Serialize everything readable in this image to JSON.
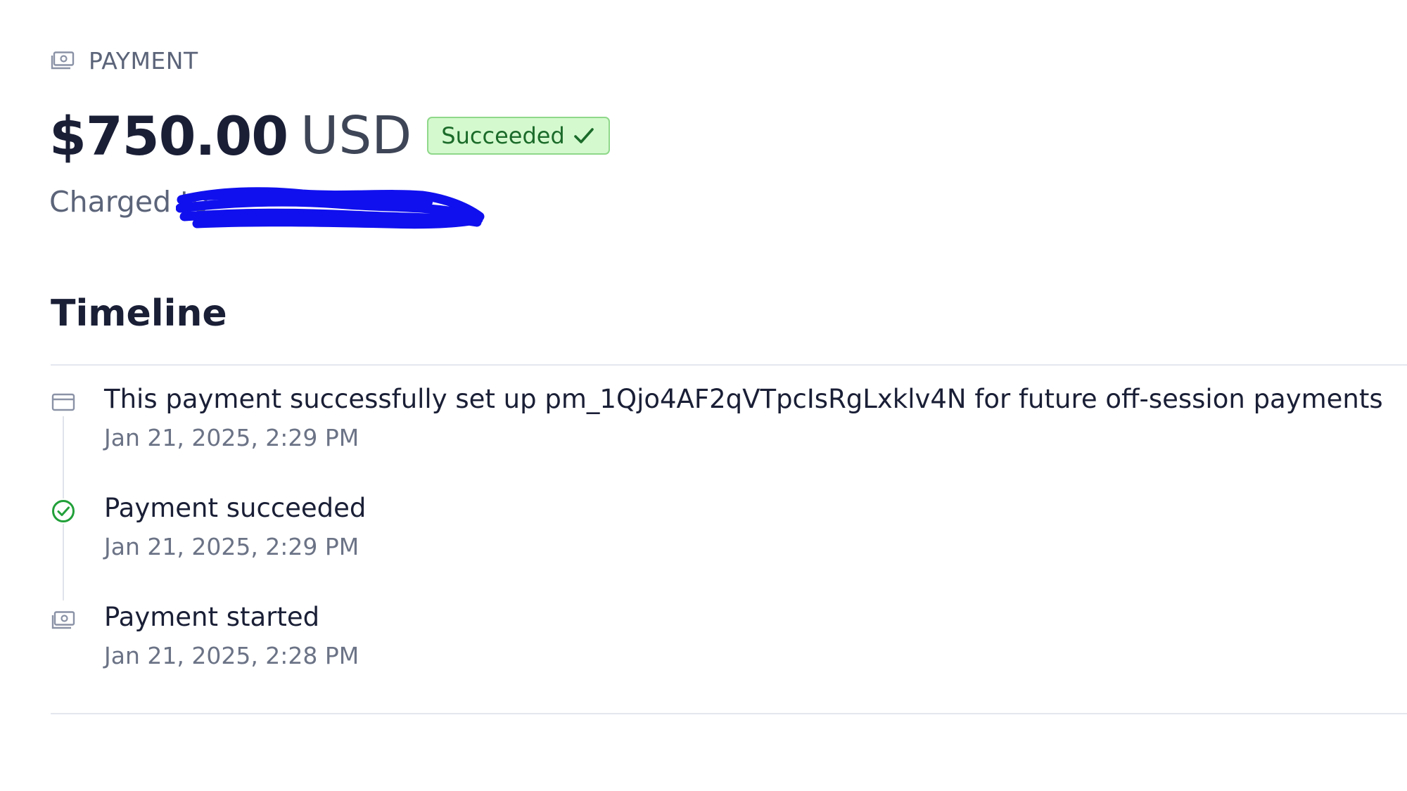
{
  "header": {
    "section_label": "PAYMENT",
    "icon": "payment-icon"
  },
  "payment": {
    "amount": "$750.00",
    "currency": "USD",
    "status": "Succeeded",
    "status_icon": "checkmark-icon",
    "charged_label": "Charged to"
  },
  "timeline": {
    "title": "Timeline",
    "items": [
      {
        "icon": "card-icon",
        "title": "This payment successfully set up pm_1Qjo4AF2qVTpcIsRgLxklv4N for future off-session payments",
        "time": "Jan 21, 2025, 2:29 PM"
      },
      {
        "icon": "check-circle-icon",
        "title": "Payment succeeded",
        "time": "Jan 21, 2025, 2:29 PM"
      },
      {
        "icon": "payment-icon",
        "title": "Payment started",
        "time": "Jan 21, 2025, 2:28 PM"
      }
    ]
  },
  "colors": {
    "success_bg": "#d5f9cf",
    "success_border": "#8fd88a",
    "success_text": "#1b6b2a",
    "success_icon": "#22a03a",
    "redaction": "#1010ee"
  }
}
